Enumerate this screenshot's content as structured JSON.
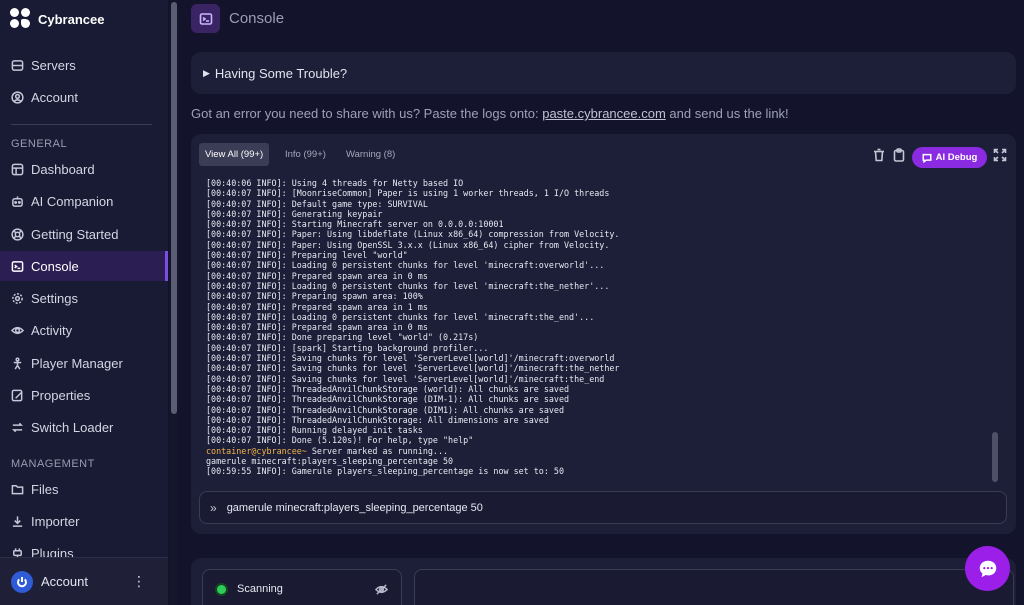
{
  "brand": {
    "name": "Cybrancee"
  },
  "nav_top": [
    {
      "label": "Servers",
      "icon": "server-icon"
    },
    {
      "label": "Account",
      "icon": "user-circle-icon"
    }
  ],
  "sections": {
    "general": "GENERAL",
    "management": "MANAGEMENT"
  },
  "nav_general": [
    {
      "label": "Dashboard",
      "icon": "dashboard-icon"
    },
    {
      "label": "AI Companion",
      "icon": "robot-icon"
    },
    {
      "label": "Getting Started",
      "icon": "lifebuoy-icon"
    },
    {
      "label": "Console",
      "icon": "terminal-icon",
      "active": true
    },
    {
      "label": "Settings",
      "icon": "gear-icon"
    },
    {
      "label": "Activity",
      "icon": "eye-icon"
    },
    {
      "label": "Player Manager",
      "icon": "person-icon"
    },
    {
      "label": "Properties",
      "icon": "edit-file-icon"
    },
    {
      "label": "Switch Loader",
      "icon": "switch-arrows-icon"
    }
  ],
  "nav_management": [
    {
      "label": "Files",
      "icon": "folder-icon"
    },
    {
      "label": "Importer",
      "icon": "download-icon"
    },
    {
      "label": "Plugins",
      "icon": "plug-icon"
    }
  ],
  "sidebar_footer": {
    "label": "Account"
  },
  "page": {
    "title": "Console"
  },
  "trouble": {
    "label": "Having Some Trouble?"
  },
  "help": {
    "before": "Got an error you need to share with us? Paste the logs onto: ",
    "link": "paste.cybrancee.com",
    "after": " and send us the link!"
  },
  "console": {
    "tabs": [
      {
        "label": "View All (99+)",
        "active": true
      },
      {
        "label": "Info (99+)"
      },
      {
        "label": "Warning (8)"
      }
    ],
    "ai_button": "AI Debug",
    "lines": [
      "[00:40:06 INFO]: Using 4 threads for Netty based IO",
      "[00:40:07 INFO]: [MoonriseCommon] Paper is using 1 worker threads, 1 I/O threads",
      "[00:40:07 INFO]: Default game type: SURVIVAL",
      "[00:40:07 INFO]: Generating keypair",
      "[00:40:07 INFO]: Starting Minecraft server on 0.0.0.0:10001",
      "[00:40:07 INFO]: Paper: Using libdeflate (Linux x86_64) compression from Velocity.",
      "[00:40:07 INFO]: Paper: Using OpenSSL 3.x.x (Linux x86_64) cipher from Velocity.",
      "[00:40:07 INFO]: Preparing level \"world\"",
      "[00:40:07 INFO]: Loading 0 persistent chunks for level 'minecraft:overworld'...",
      "[00:40:07 INFO]: Prepared spawn area in 0 ms",
      "[00:40:07 INFO]: Loading 0 persistent chunks for level 'minecraft:the_nether'...",
      "[00:40:07 INFO]: Preparing spawn area: 100%",
      "[00:40:07 INFO]: Prepared spawn area in 1 ms",
      "[00:40:07 INFO]: Loading 0 persistent chunks for level 'minecraft:the_end'...",
      "[00:40:07 INFO]: Prepared spawn area in 0 ms",
      "[00:40:07 INFO]: Done preparing level \"world\" (0.217s)",
      "[00:40:07 INFO]: [spark] Starting background profiler...",
      "[00:40:07 INFO]: Saving chunks for level 'ServerLevel[world]'/minecraft:overworld",
      "[00:40:07 INFO]: Saving chunks for level 'ServerLevel[world]'/minecraft:the_nether",
      "[00:40:07 INFO]: Saving chunks for level 'ServerLevel[world]'/minecraft:the_end",
      "[00:40:07 INFO]: ThreadedAnvilChunkStorage (world): All chunks are saved",
      "[00:40:07 INFO]: ThreadedAnvilChunkStorage (DIM-1): All chunks are saved",
      "[00:40:07 INFO]: ThreadedAnvilChunkStorage (DIM1): All chunks are saved",
      "[00:40:07 INFO]: ThreadedAnvilChunkStorage: All dimensions are saved",
      "[00:40:07 INFO]: Running delayed init tasks",
      "[00:40:07 INFO]: Done (5.120s)! For help, type \"help\""
    ],
    "prompt": "container@cybrancee~",
    "prompt_text": " Server marked as running...",
    "lines_after": [
      "gamerule minecraft:players_sleeping_percentage 50",
      "[00:59:55 INFO]: Gamerule players_sleeping_percentage is now set to: 50"
    ],
    "command_value": "gamerule minecraft:players_sleeping_percentage 50"
  },
  "status": {
    "label": "Scanning",
    "color": "#2ecc5a"
  },
  "colors": {
    "accent": "#8a2be2",
    "prompt": "#f0b44a"
  }
}
